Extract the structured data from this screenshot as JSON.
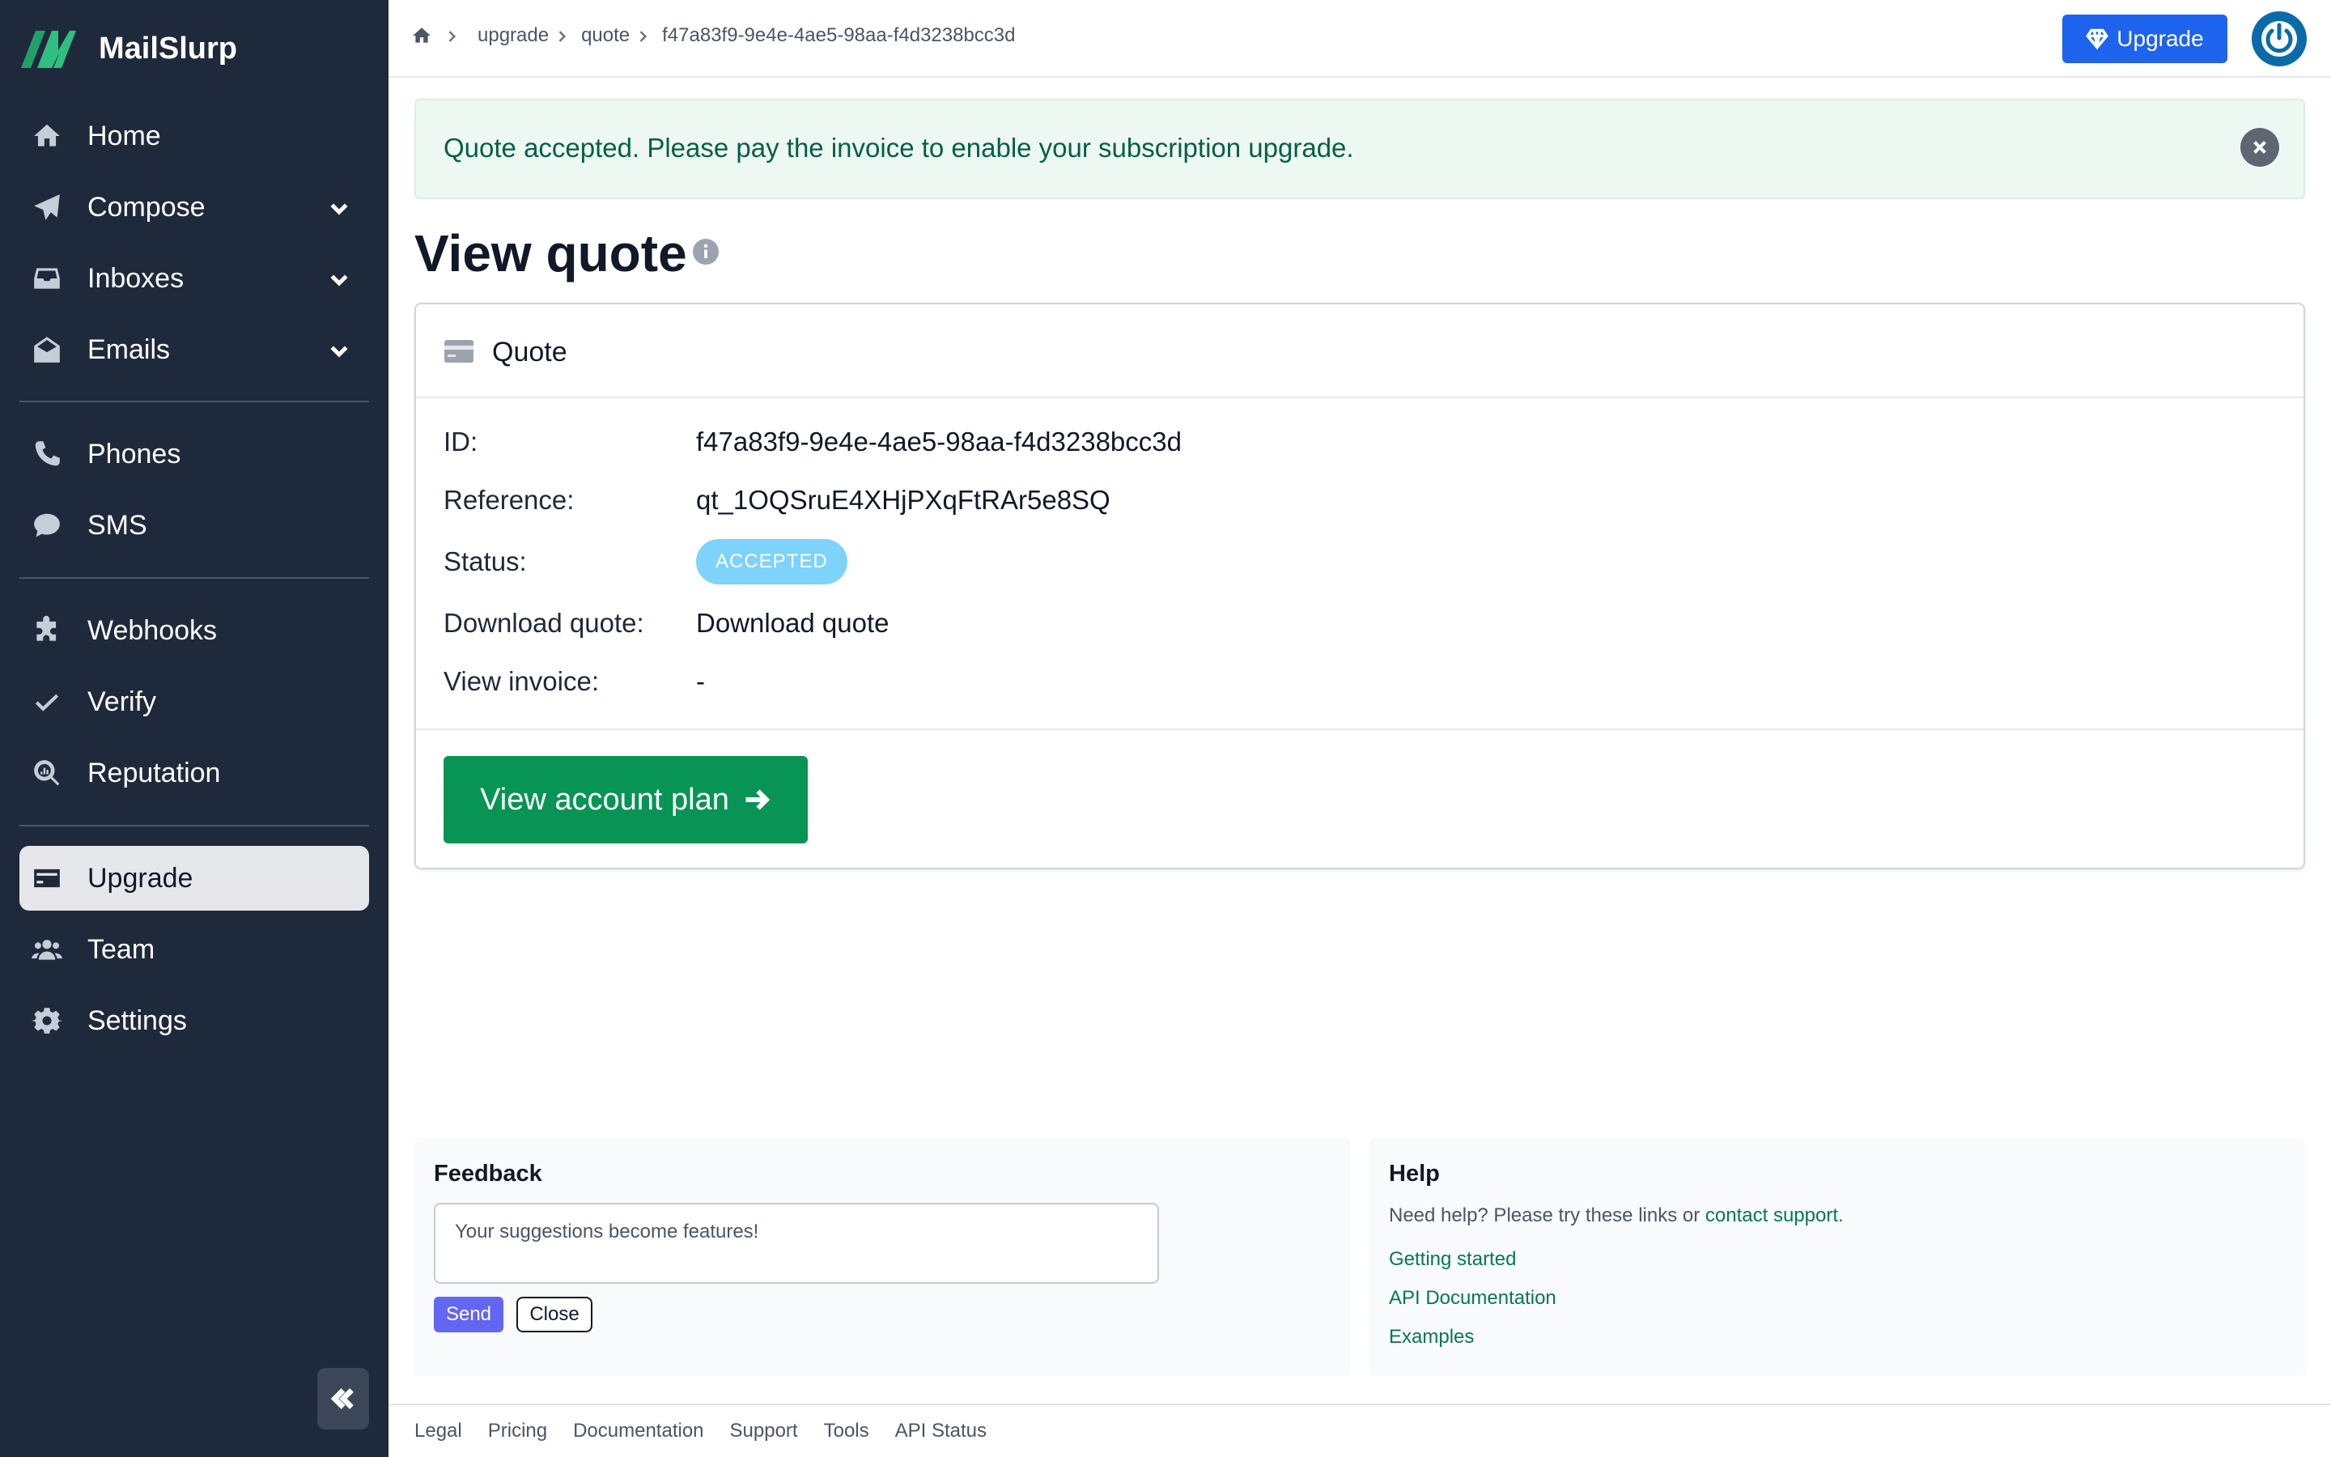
{
  "brand": {
    "name": "MailSlurp"
  },
  "sidebar": {
    "items": [
      {
        "label": "Home",
        "icon": "home-icon"
      },
      {
        "label": "Compose",
        "icon": "paper-plane-icon"
      },
      {
        "label": "Inboxes",
        "icon": "inbox-icon"
      },
      {
        "label": "Emails",
        "icon": "envelope-open-icon"
      },
      {
        "label": "Phones",
        "icon": "phone-icon"
      },
      {
        "label": "SMS",
        "icon": "sms-icon"
      },
      {
        "label": "Webhooks",
        "icon": "puzzle-icon"
      },
      {
        "label": "Verify",
        "icon": "check-icon"
      },
      {
        "label": "Reputation",
        "icon": "magnifier-chart-icon"
      },
      {
        "label": "Upgrade",
        "icon": "credit-card-icon"
      },
      {
        "label": "Team",
        "icon": "users-icon"
      },
      {
        "label": "Settings",
        "icon": "gear-icon"
      }
    ],
    "active": "Upgrade"
  },
  "topbar": {
    "breadcrumbs": [
      "upgrade",
      "quote",
      "f47a83f9-9e4e-4ae5-98aa-f4d3238bcc3d"
    ],
    "upgrade_label": "Upgrade"
  },
  "alert": {
    "message": "Quote accepted. Please pay the invoice to enable your subscription upgrade."
  },
  "page": {
    "title": "View quote"
  },
  "quote": {
    "card_title": "Quote",
    "fields": {
      "id_label": "ID:",
      "id_value": "f47a83f9-9e4e-4ae5-98aa-f4d3238bcc3d",
      "reference_label": "Reference:",
      "reference_value": "qt_1OQSruE4XHjPXqFtRAr5e8SQ",
      "status_label": "Status:",
      "status_value": "ACCEPTED",
      "download_label": "Download quote:",
      "download_link": "Download quote",
      "invoice_label": "View invoice:",
      "invoice_value": "-"
    },
    "action_label": "View account plan"
  },
  "feedback": {
    "title": "Feedback",
    "placeholder": "Your suggestions become features!",
    "send_label": "Send",
    "close_label": "Close"
  },
  "help": {
    "title": "Help",
    "text_prefix": "Need help? Please try these links or ",
    "contact_link": "contact support",
    "text_suffix": ".",
    "links": [
      "Getting started",
      "API Documentation",
      "Examples"
    ]
  },
  "footer": {
    "links": [
      "Legal",
      "Pricing",
      "Documentation",
      "Support",
      "Tools",
      "API Status"
    ]
  },
  "colors": {
    "sidebar_bg": "#1e2a3b",
    "accent_green": "#079455",
    "upgrade_blue": "#1d63ed",
    "status_badge": "#7dd3fc",
    "alert_bg": "#eef8f3"
  }
}
